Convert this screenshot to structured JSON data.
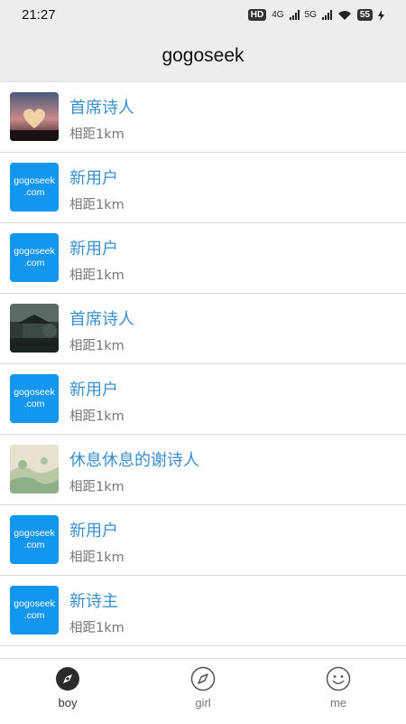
{
  "status_bar": {
    "time": "21:27",
    "hd_label": "HD",
    "net_4g": "4G",
    "net_5g": "5G",
    "battery": "55"
  },
  "header": {
    "title": "gogoseek"
  },
  "colors": {
    "logo_blue": "#1296f0",
    "name_blue": "#3a8fcf"
  },
  "users": [
    {
      "name": "首席诗人",
      "distance": "相距1km",
      "avatar": "heart-photo"
    },
    {
      "name": "新用户",
      "distance": "相距1km",
      "avatar": "gogoseek-logo",
      "logo_line1": "gogoseek",
      "logo_line2": ".com"
    },
    {
      "name": "新用户",
      "distance": "相距1km",
      "avatar": "gogoseek-logo",
      "logo_line1": "gogoseek",
      "logo_line2": ".com"
    },
    {
      "name": "首席诗人",
      "distance": "相距1km",
      "avatar": "pavilion-photo"
    },
    {
      "name": "新用户",
      "distance": "相距1km",
      "avatar": "gogoseek-logo",
      "logo_line1": "gogoseek",
      "logo_line2": ".com"
    },
    {
      "name": "休息休息的谢诗人",
      "distance": "相距1km",
      "avatar": "landscape-painting"
    },
    {
      "name": "新用户",
      "distance": "相距1km",
      "avatar": "gogoseek-logo",
      "logo_line1": "gogoseek",
      "logo_line2": ".com"
    },
    {
      "name": "新诗主",
      "distance": "相距1km",
      "avatar": "gogoseek-logo",
      "logo_line1": "gogoseek",
      "logo_line2": ".com"
    }
  ],
  "bottom_nav": [
    {
      "label": "boy",
      "icon": "compass-filled-icon",
      "active": true
    },
    {
      "label": "girl",
      "icon": "compass-outline-icon",
      "active": false
    },
    {
      "label": "me",
      "icon": "smiley-icon",
      "active": false
    }
  ]
}
